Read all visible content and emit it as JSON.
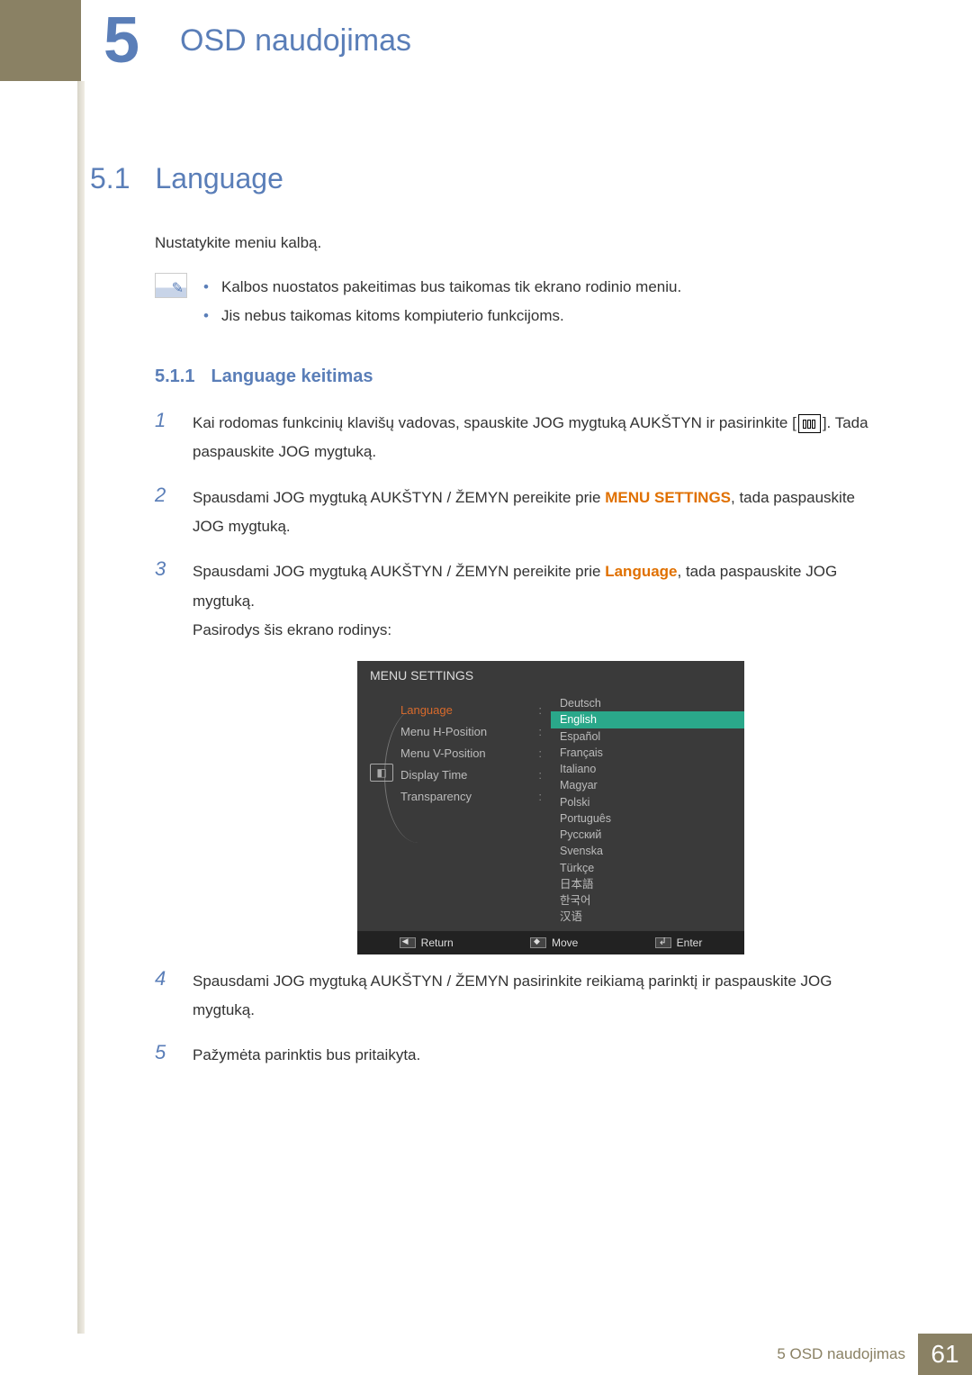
{
  "chapter": {
    "number": "5",
    "title": "OSD naudojimas"
  },
  "section": {
    "number": "5.1",
    "title": "Language"
  },
  "intro": "Nustatykite meniu kalbą.",
  "notes": [
    "Kalbos nuostatos pakeitimas bus taikomas tik ekrano rodinio meniu.",
    "Jis nebus taikomas kitoms kompiuterio funkcijoms."
  ],
  "subsection": {
    "number": "5.1.1",
    "title": "Language keitimas"
  },
  "steps": {
    "s1a": "Kai rodomas funkcinių klavišų vadovas, spauskite JOG mygtuką AUKŠTYN ir pasirinkite [",
    "s1b": "]. Tada paspauskite JOG mygtuką.",
    "s2a": "Spausdami JOG mygtuką AUKŠTYN / ŽEMYN pereikite prie ",
    "s2hl": "MENU SETTINGS",
    "s2b": ", tada paspauskite JOG mygtuką.",
    "s3a": "Spausdami JOG mygtuką AUKŠTYN / ŽEMYN pereikite prie ",
    "s3hl": "Language",
    "s3b": ", tada paspauskite JOG mygtuką.",
    "s3c": "Pasirodys šis ekrano rodinys:",
    "s4": "Spausdami JOG mygtuką AUKŠTYN / ŽEMYN pasirinkite reikiamą parinktį ir paspauskite JOG mygtuką.",
    "s5": "Pažymėta parinktis bus pritaikyta."
  },
  "osd": {
    "title": "MENU SETTINGS",
    "left": [
      "Language",
      "Menu H-Position",
      "Menu V-Position",
      "Display Time",
      "Transparency"
    ],
    "langs": [
      "Deutsch",
      "English",
      "Español",
      "Français",
      "Italiano",
      "Magyar",
      "Polski",
      "Português",
      "Русский",
      "Svenska",
      "Türkçe",
      "日本語",
      "한국어",
      "汉语"
    ],
    "selected": "English",
    "footer": {
      "return": "Return",
      "move": "Move",
      "enter": "Enter"
    }
  },
  "footer": {
    "label": "5 OSD naudojimas",
    "page": "61"
  }
}
